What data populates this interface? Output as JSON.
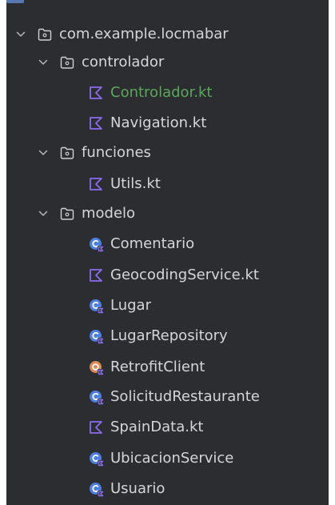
{
  "project_tree": {
    "items": [
      {
        "label": "com.example.locmabar",
        "icon": "package-folder-icon",
        "expanded": true
      },
      {
        "label": "controlador",
        "icon": "package-folder-icon",
        "expanded": true
      },
      {
        "label": "Controlador.kt",
        "icon": "kotlin-file-icon",
        "highlight_color": "#5ba85b"
      },
      {
        "label": "Navigation.kt",
        "icon": "kotlin-file-icon"
      },
      {
        "label": "funciones",
        "icon": "package-folder-icon",
        "expanded": true
      },
      {
        "label": "Utils.kt",
        "icon": "kotlin-file-icon"
      },
      {
        "label": "modelo",
        "icon": "package-folder-icon",
        "expanded": true
      },
      {
        "label": "Comentario",
        "icon": "kotlin-class-icon"
      },
      {
        "label": "GeocodingService.kt",
        "icon": "kotlin-file-icon"
      },
      {
        "label": "Lugar",
        "icon": "kotlin-class-icon"
      },
      {
        "label": "LugarRepository",
        "icon": "kotlin-class-icon"
      },
      {
        "label": "RetrofitClient",
        "icon": "kotlin-object-icon"
      },
      {
        "label": "SolicitudRestaurante",
        "icon": "kotlin-class-icon"
      },
      {
        "label": "SpainData.kt",
        "icon": "kotlin-file-icon"
      },
      {
        "label": "UbicacionService",
        "icon": "kotlin-class-icon"
      },
      {
        "label": "Usuario",
        "icon": "kotlin-class-icon"
      }
    ]
  },
  "colors": {
    "background": "#2b2d30",
    "text": "#d4d6da",
    "kotlin_file": "#8a6cf0",
    "class_icon": "#4c7fe0",
    "object_icon": "#d98a55",
    "modified_file": "#5ba85b"
  }
}
